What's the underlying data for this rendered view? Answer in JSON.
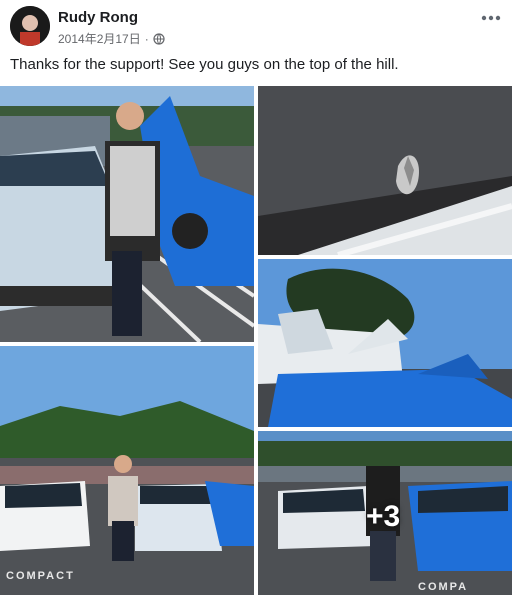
{
  "post": {
    "author": "Rudy Rong",
    "date": "2014年2月17日",
    "separator": "·",
    "privacy_icon": "globe-icon",
    "menu_icon": "more-options-icon",
    "text": "Thanks for the support! See you guys on the top of the hill."
  },
  "gallery": {
    "more_count": "+3",
    "ground_labels": {
      "photo3": "COMPACT",
      "photo5": "COMPA"
    }
  },
  "colors": {
    "name": "#1c1e21",
    "meta": "#65676b",
    "blue_car": "#1f6fd8",
    "white_car": "#f0f2f5"
  }
}
